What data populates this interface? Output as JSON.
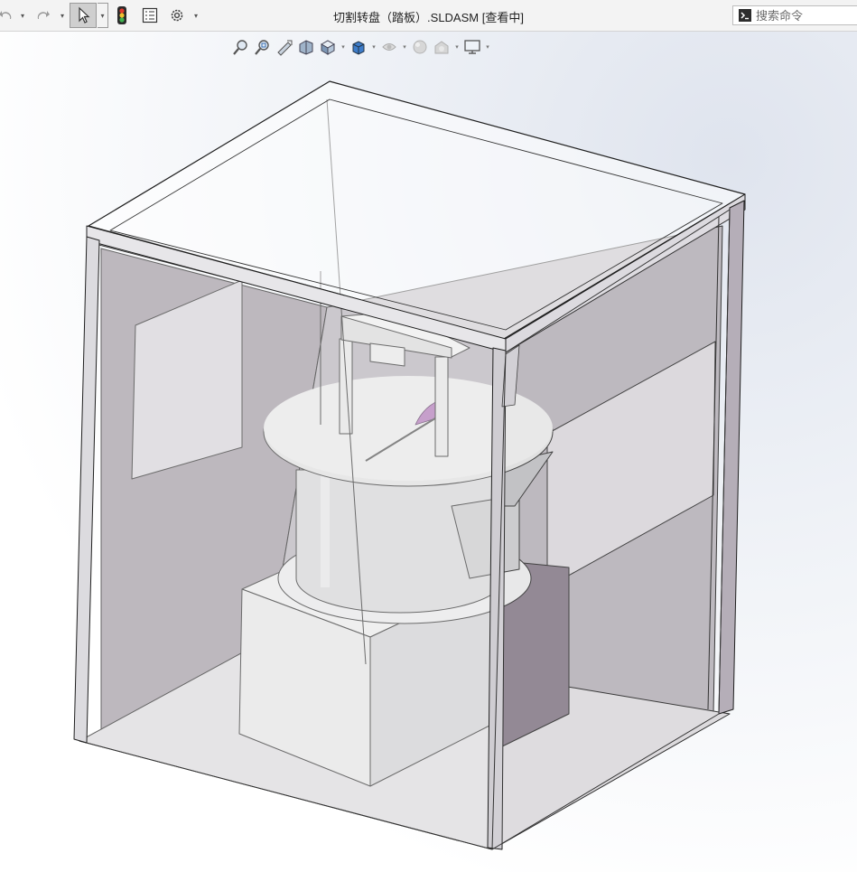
{
  "window": {
    "title": "切割转盘（踏板）.SLDASM [查看中]"
  },
  "search": {
    "placeholder": "搜索命令"
  },
  "toolbar": {
    "undo_icon": "undo-icon",
    "redo_icon": "redo-icon",
    "select_icon": "select-arrow-icon",
    "rebuild_icon": "traffic-light-icon",
    "file_properties_icon": "file-properties-icon",
    "options_icon": "gear-icon"
  },
  "view_toolbar": {
    "items": [
      "zoom-to-fit-icon",
      "zoom-to-area-icon",
      "previous-view-icon",
      "section-view-icon",
      "view-orientation-icon",
      "display-style-icon",
      "hide-show-items-icon",
      "edit-appearance-icon",
      "apply-scene-icon",
      "view-settings-icon"
    ]
  },
  "colors": {
    "accent_purple": "#b07ab8",
    "frame_edge": "#1f1f1f",
    "panel_gray": "#a8a1a8"
  }
}
